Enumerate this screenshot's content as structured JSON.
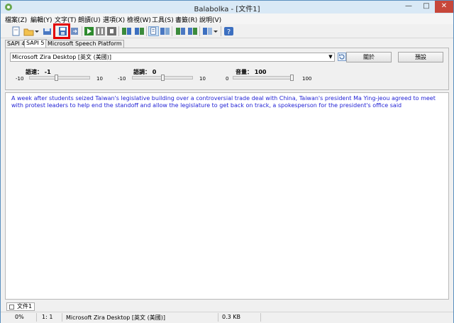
{
  "window": {
    "title": "Balabolka - [文件1]",
    "min_label": "—",
    "max_label": "□",
    "close_label": "✕"
  },
  "menu": [
    {
      "label": "檔案(Z)"
    },
    {
      "label": "編輯(Y)"
    },
    {
      "label": "文字(T)"
    },
    {
      "label": "朗讀(U)"
    },
    {
      "label": "選項(X)"
    },
    {
      "label": "檢視(W)"
    },
    {
      "label": "工具(S)"
    },
    {
      "label": "書籤(R)"
    },
    {
      "label": "說明(V)"
    }
  ],
  "toolbar": {
    "icons": [
      "new-document-icon",
      "open-folder-icon",
      "dropdown-arrow-icon",
      "save-audio-icon",
      "save-file-icon",
      "convert-icon",
      "play-icon",
      "pause-icon",
      "stop-icon",
      "voice-settings-icon",
      "pronunciation-icon",
      "view-page-icon",
      "view-book-icon",
      "bookmark-icon",
      "text-export-icon",
      "read-aloud-icon",
      "dropdown-arrow-icon",
      "help-icon"
    ],
    "highlight_color": "#e30000"
  },
  "tabs": [
    {
      "label": "SAPI 4",
      "active": false
    },
    {
      "label": "SAPI 5",
      "active": true
    },
    {
      "label": "Microsoft Speech Platform",
      "active": false
    }
  ],
  "voice": {
    "selected": "Microsoft Zira Desktop [英文 (美國)]",
    "about_label": "關於",
    "defaults_label": "預設"
  },
  "sliders": {
    "rate": {
      "label": "語速：",
      "value_text": "-1",
      "value": -1,
      "min": -10,
      "max": 10,
      "min_label": "-10",
      "max_label": "10"
    },
    "pitch": {
      "label": "語調：",
      "value_text": "0",
      "value": 0,
      "min": -10,
      "max": 10,
      "min_label": "-10",
      "max_label": "10"
    },
    "volume": {
      "label": "音量：",
      "value_text": "100",
      "value": 100,
      "min": 0,
      "max": 100,
      "min_label": "0",
      "max_label": "100"
    }
  },
  "editor": {
    "text": "A week after students seized Taiwan's legislative building over a controversial trade deal with China, Taiwan's president Ma Ying-jeou agreed to meet with protest leaders to help end the standoff and allow the legislature to get back on track, a spokesperson for the president's office said",
    "text_color": "#1e1ed4"
  },
  "doc_tabs": [
    {
      "label": "文件1"
    }
  ],
  "status": {
    "progress": "0%",
    "position": "1:   1",
    "voice": "Microsoft Zira Desktop [英文 (美國)]",
    "size": "0.3 KB"
  }
}
